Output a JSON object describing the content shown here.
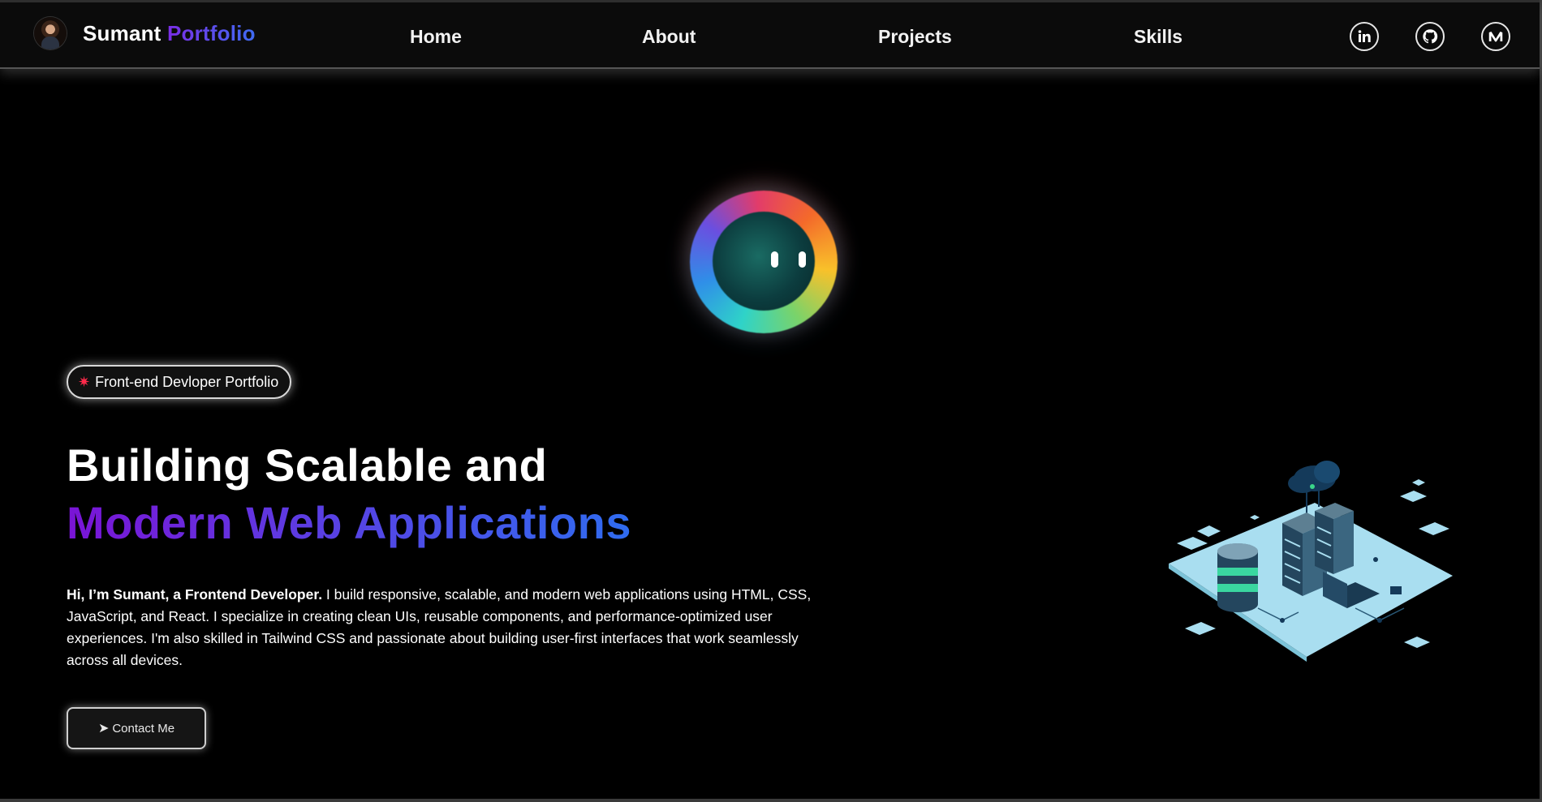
{
  "brand": {
    "name": "Sumant",
    "accent": "Portfolio"
  },
  "nav": {
    "home": "Home",
    "about": "About",
    "projects": "Projects",
    "skills": "Skills"
  },
  "social": {
    "linkedin_icon": "linkedin-icon",
    "github_icon": "github-icon",
    "medium_icon": "medium-icon"
  },
  "badge": {
    "label": "Front-end Devloper Portfolio"
  },
  "hero": {
    "line1": "Building Scalable and",
    "line2": "Modern Web Applications",
    "intro_bold": "Hi, I’m Sumant, a Frontend Developer.",
    "intro_rest": " I build responsive, scalable, and modern web applications using HTML, CSS, JavaScript, and React. I specialize in creating clean UIs, reusable components, and performance-optimized user experiences. I'm also skilled in Tailwind CSS and passionate about building user-first interfaces that work seamlessly across all devices.",
    "cta_label": "Contact Me",
    "cta_icon": "send-arrow-icon"
  },
  "colors": {
    "background": "#000000",
    "navbar": "#0b0b0b",
    "gradient_start": "#7a14d6",
    "gradient_end": "#2f6cf0",
    "badge_star": "#ff2a4a"
  }
}
